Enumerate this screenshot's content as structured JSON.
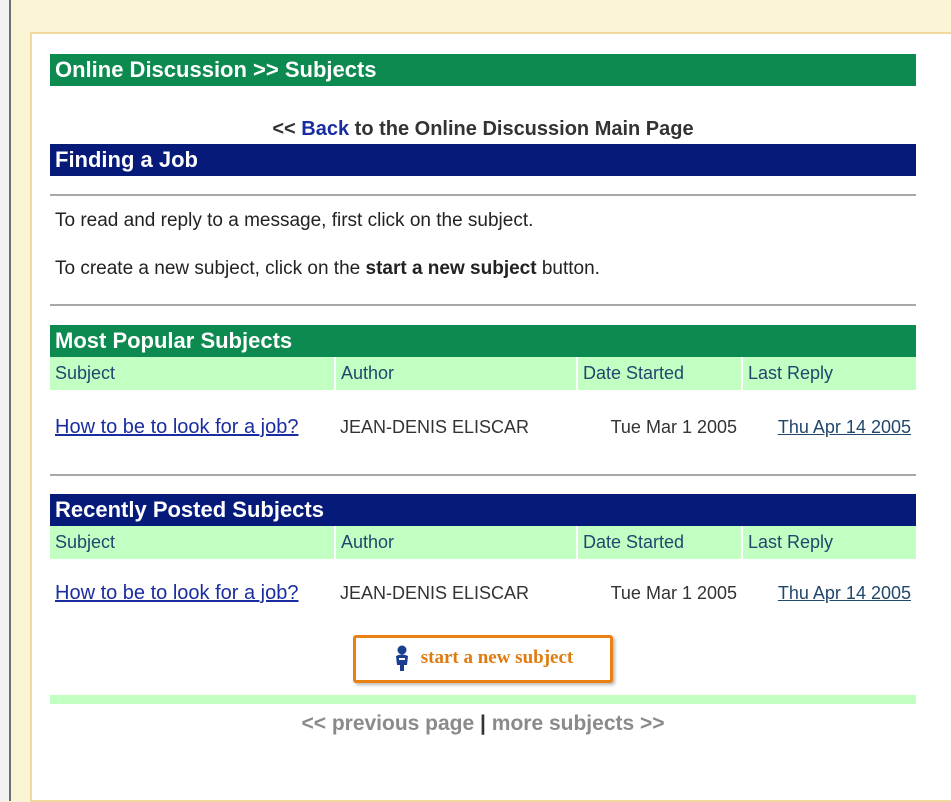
{
  "header": {
    "title": "Online Discussion >> Subjects"
  },
  "back": {
    "prefix": "<< ",
    "link": "Back",
    "suffix": " to the Online Discussion Main Page"
  },
  "section": {
    "title": "Finding a Job"
  },
  "instructions": {
    "line1": "To read and reply to a message, first click on the subject.",
    "line2_a": "To create a new subject, click on the ",
    "line2_bold": "start a new subject",
    "line2_b": " button."
  },
  "popular": {
    "title": "Most Popular Subjects",
    "columns": [
      "Subject",
      "Author",
      "Date Started",
      "Last Reply"
    ],
    "rows": [
      {
        "subject": "How to be to look for a job?",
        "author": "JEAN-DENIS ELISCAR",
        "date_started": "Tue Mar 1 2005",
        "last_reply": "Thu Apr 14 2005"
      }
    ]
  },
  "recent": {
    "title": "Recently Posted Subjects",
    "columns": [
      "Subject",
      "Author",
      "Date Started",
      "Last Reply"
    ],
    "rows": [
      {
        "subject": "How to be to look for a job?",
        "author": "JEAN-DENIS ELISCAR",
        "date_started": "Tue Mar 1 2005",
        "last_reply": "Thu Apr 14 2005"
      }
    ]
  },
  "actions": {
    "start_new_subject": "start a new subject"
  },
  "pager": {
    "prev": "<< previous page",
    "sep": "|",
    "next": "more subjects >>"
  },
  "colors": {
    "green": "#0d8a4f",
    "navy": "#061a7a",
    "light_green": "#c2ffc2",
    "orange": "#ea7f14"
  }
}
